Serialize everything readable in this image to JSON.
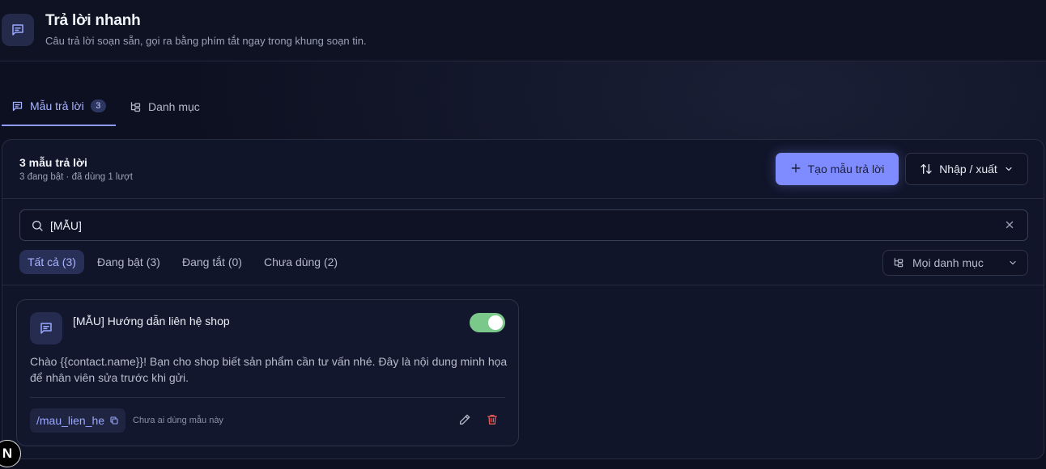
{
  "header": {
    "title": "Trả lời nhanh",
    "subtitle": "Câu trả lời soạn sẵn, gọi ra bằng phím tắt ngay trong khung soạn tin.",
    "icon": "message-square-icon"
  },
  "tabs": [
    {
      "label": "Mẫu trả lời",
      "badge": "3",
      "icon": "message-square-icon",
      "active": true
    },
    {
      "label": "Danh mục",
      "icon": "folder-tree-icon",
      "active": false
    }
  ],
  "panel": {
    "count_title": "3 mẫu trả lời",
    "count_sub": "3 đang bật · đã dùng 1 lượt",
    "create_button": "Tạo mẫu trả lời",
    "io_button": "Nhập / xuất",
    "search": {
      "value": "[MẪU]"
    },
    "filters": [
      {
        "label": "Tất cả (3)",
        "active": true
      },
      {
        "label": "Đang bật (3)",
        "active": false
      },
      {
        "label": "Đang tắt (0)",
        "active": false
      },
      {
        "label": "Chưa dùng (2)",
        "active": false
      }
    ],
    "category_select": {
      "value": "Mọi danh mục"
    }
  },
  "cards": [
    {
      "title": "[MẪU] Hướng dẫn liên hệ shop",
      "enabled": true,
      "body": "Chào {{contact.name}}! Bạn cho shop biết sản phẩm cần tư vấn nhé. Đây là nội dung minh họa để nhân viên sửa trước khi gửi.",
      "shortcut": "/mau_lien_he",
      "usage": "Chưa ai dùng mẫu này"
    }
  ],
  "floating_badge": "N",
  "colors": {
    "accent": "#7f8cff",
    "toggle_on": "#7ac98b",
    "delete": "#e05a5a",
    "background": "#0d1020"
  }
}
